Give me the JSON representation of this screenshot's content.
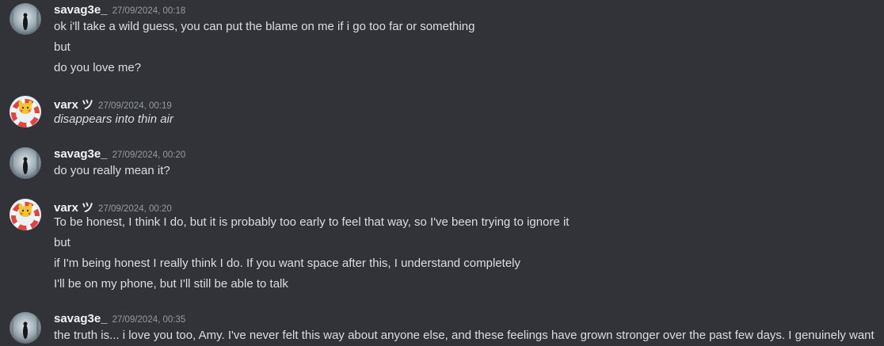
{
  "messages": [
    {
      "username": "savag3e_",
      "timestamp": "27/09/2024, 00:18",
      "lines": [
        "ok i'll take a wild guess, you can put the blame on me if i go too far or something",
        "but",
        "do you love me?"
      ]
    },
    {
      "username": "varx ツ",
      "timestamp": "27/09/2024, 00:19",
      "lines": [
        "disappears into thin air"
      ]
    },
    {
      "username": "savag3e_",
      "timestamp": "27/09/2024, 00:20",
      "lines": [
        "do you really mean it?"
      ]
    },
    {
      "username": "varx ツ",
      "timestamp": "27/09/2024, 00:20",
      "lines": [
        "To be honest, I think I do, but it is probably too early to feel that way, so I've been trying to ignore it",
        "but",
        "if I'm being honest I really think I do. If you want space after this, I understand completely",
        "I'll be on my phone, but I'll still be able to talk"
      ]
    },
    {
      "username": "savag3e_",
      "timestamp": "27/09/2024, 00:35",
      "lines": [
        "the truth is... i love you too, Amy. I've never felt this way about anyone else, and these feelings have grown stronger over the past few days. I genuinely want"
      ]
    }
  ]
}
